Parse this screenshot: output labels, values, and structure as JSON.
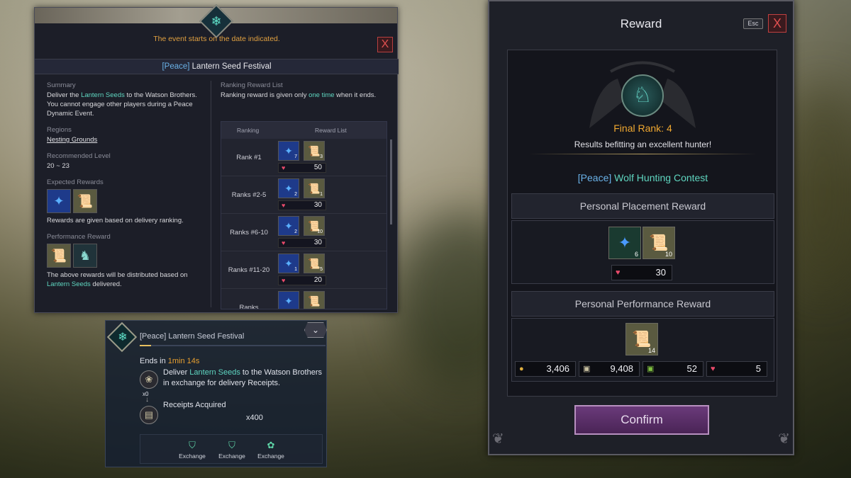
{
  "event_panel": {
    "notice": "The event starts on the date indicated.",
    "close": "X",
    "title_tag": "[Peace]",
    "title": "Lantern Seed Festival",
    "summary_label": "Summary",
    "summary_p1_a": "Deliver the ",
    "summary_p1_hl": "Lantern Seeds",
    "summary_p1_b": " to the Watson Brothers.",
    "summary_p2": "You cannot engage other players during a Peace Dynamic Event.",
    "regions_label": "Regions",
    "region": "Nesting Grounds",
    "level_label": "Recommended Level",
    "level": "20 ~ 23",
    "expected_label": "Expected Rewards",
    "expected_note": "Rewards are given based on delivery ranking.",
    "performance_label": "Performance Reward",
    "performance_note_a": "The above rewards will be distributed based on ",
    "performance_note_hl": "Lantern Seeds",
    "performance_note_b": " delivered.",
    "ranking_label": "Ranking Reward List",
    "ranking_note_a": "Ranking reward is given only ",
    "ranking_note_hl": "one time",
    "ranking_note_b": " when it ends.",
    "table_head_rank": "Ranking",
    "table_head_rewards": "Reward List",
    "rows": [
      {
        "rank": "Rank #1",
        "q1": "7",
        "q2": "3",
        "hearts": "50"
      },
      {
        "rank": "Ranks #2-5",
        "q1": "2",
        "q2": "1",
        "hearts": "30"
      },
      {
        "rank": "Ranks #6-10",
        "q1": "2",
        "q2": "10",
        "hearts": "30"
      },
      {
        "rank": "Ranks #11-20",
        "q1": "1",
        "q2": "5",
        "hearts": "20"
      },
      {
        "rank": "Ranks",
        "q1": "",
        "q2": "",
        "hearts": ""
      }
    ]
  },
  "tracker": {
    "title": "[Peace] Lantern Seed Festival",
    "progress": 0.06,
    "ends_label": "Ends in ",
    "ends_value": "1min 14s",
    "deliver_a": "Deliver ",
    "deliver_hl": "Lantern Seeds",
    "deliver_b": " to the Watson Brothers in exchange for delivery Receipts.",
    "seed_count": "x0",
    "receipts_label": "Receipts Acquired",
    "receipts_count": "x400",
    "exchange": [
      "Exchange",
      "Exchange",
      "Exchange"
    ]
  },
  "reward_panel": {
    "title": "Reward",
    "esc": "Esc",
    "close": "X",
    "final_rank": "Final Rank: 4",
    "description": "Results befitting an excellent hunter!",
    "event_tag": "[Peace]",
    "event_name": "Wolf Hunting Contest",
    "placement_header": "Personal Placement Reward",
    "placement_items": [
      {
        "icon": "blue-crystal-icon",
        "qty": "6"
      },
      {
        "icon": "scroll-icon",
        "qty": "10"
      }
    ],
    "placement_hearts": "30",
    "performance_header": "Personal Performance Reward",
    "performance_items": [
      {
        "icon": "scroll-icon",
        "qty": "14"
      }
    ],
    "currencies": [
      "3,406",
      "9,408",
      "52",
      "5"
    ],
    "confirm": "Confirm"
  },
  "colors": {
    "accent_teal": "#5fd6c0",
    "accent_orange": "#e8a030",
    "peace_blue": "#6ab2e8"
  }
}
